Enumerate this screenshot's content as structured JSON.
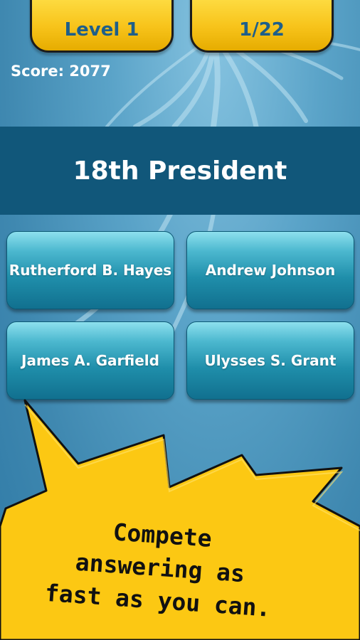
{
  "header": {
    "level_label": "Level 1",
    "progress_label": "1/22"
  },
  "score_label": "Score: 2077",
  "question": "18th President",
  "answers": [
    "Rutherford B. Hayes",
    "Andrew Johnson",
    "James A. Garfield",
    "Ulysses S. Grant"
  ],
  "promo": {
    "line1": "Compete",
    "line2": "answering as",
    "line3": "fast as you can."
  },
  "colors": {
    "tab_yellow": "#f7c31a",
    "tab_text": "#1e5f8a",
    "question_bar": "#11577a",
    "answer_button": "#1f8eaa",
    "burst_yellow": "#fcc813"
  }
}
